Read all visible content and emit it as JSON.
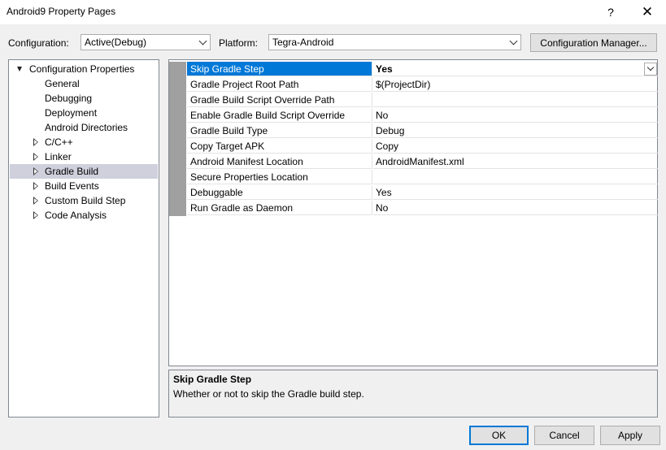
{
  "window": {
    "title": "Android9 Property Pages",
    "help_glyph": "?",
    "close_glyph": "✕"
  },
  "toolbar": {
    "configuration_label": "Configuration:",
    "configuration_value": "Active(Debug)",
    "platform_label": "Platform:",
    "platform_value": "Tegra-Android",
    "config_manager_label": "Configuration Manager..."
  },
  "tree": {
    "items": [
      {
        "label": "Configuration Properties",
        "level": 0,
        "arrow": "expanded"
      },
      {
        "label": "General",
        "level": 1,
        "arrow": "none"
      },
      {
        "label": "Debugging",
        "level": 1,
        "arrow": "none"
      },
      {
        "label": "Deployment",
        "level": 1,
        "arrow": "none"
      },
      {
        "label": "Android Directories",
        "level": 1,
        "arrow": "none"
      },
      {
        "label": "C/C++",
        "level": 1,
        "arrow": "collapsed"
      },
      {
        "label": "Linker",
        "level": 1,
        "arrow": "collapsed"
      },
      {
        "label": "Gradle Build",
        "level": 1,
        "arrow": "collapsed",
        "selected": true
      },
      {
        "label": "Build Events",
        "level": 1,
        "arrow": "collapsed"
      },
      {
        "label": "Custom Build Step",
        "level": 1,
        "arrow": "collapsed"
      },
      {
        "label": "Code Analysis",
        "level": 1,
        "arrow": "collapsed"
      }
    ]
  },
  "properties": [
    {
      "name": "Skip Gradle Step",
      "value": "Yes",
      "selected": true
    },
    {
      "name": "Gradle Project Root Path",
      "value": "$(ProjectDir)"
    },
    {
      "name": "Gradle Build Script Override Path",
      "value": ""
    },
    {
      "name": "Enable Gradle Build Script Override",
      "value": "No"
    },
    {
      "name": "Gradle Build Type",
      "value": "Debug"
    },
    {
      "name": "Copy Target APK",
      "value": "Copy"
    },
    {
      "name": "Android Manifest Location",
      "value": "AndroidManifest.xml"
    },
    {
      "name": "Secure Properties Location",
      "value": ""
    },
    {
      "name": "Debuggable",
      "value": "Yes"
    },
    {
      "name": "Run Gradle as Daemon",
      "value": "No"
    }
  ],
  "description": {
    "title": "Skip Gradle Step",
    "text": "Whether or not to skip the Gradle build step."
  },
  "buttons": {
    "ok": "OK",
    "cancel": "Cancel",
    "apply": "Apply"
  },
  "colors": {
    "selection_blue": "#0078d7",
    "tree_selection": "#cfd0dc"
  }
}
